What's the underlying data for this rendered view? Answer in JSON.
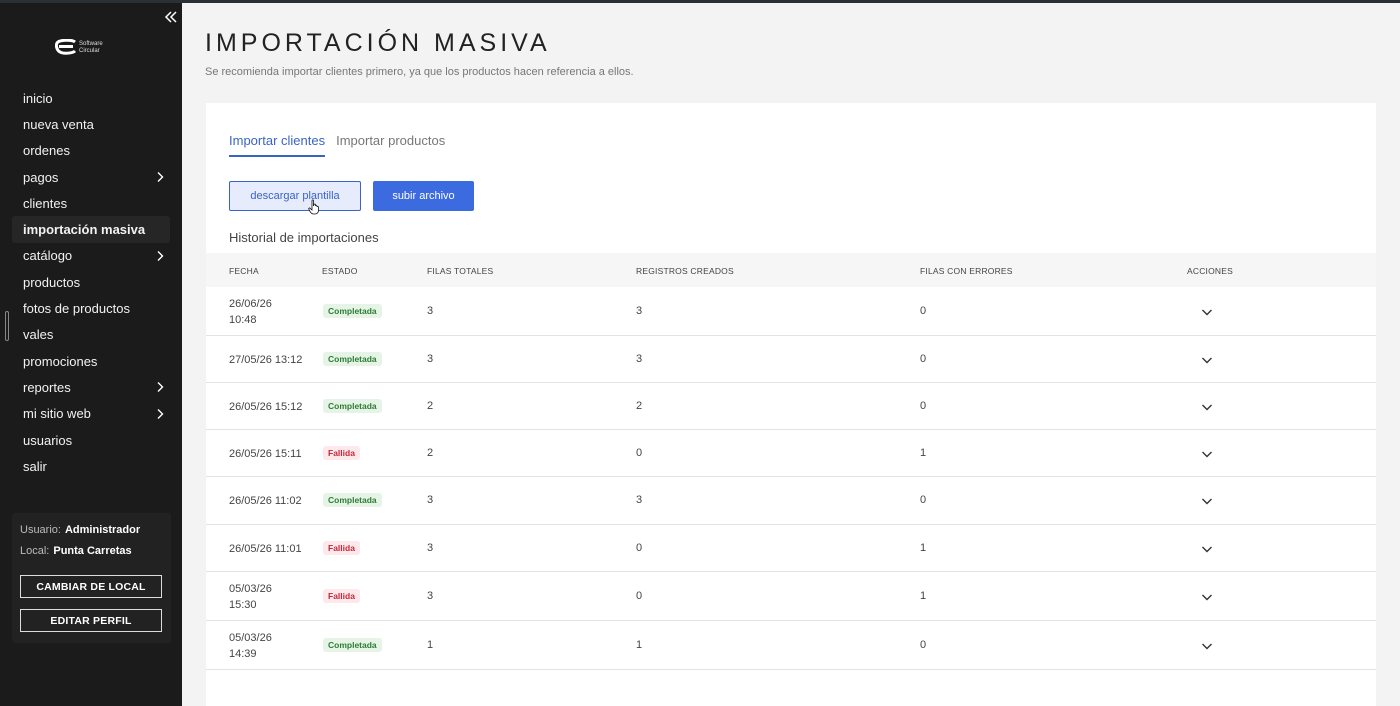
{
  "sidebar": {
    "logo_line1": "Software",
    "logo_line2": "Circular",
    "items": [
      {
        "label": "inicio",
        "has_submenu": false
      },
      {
        "label": "nueva venta",
        "has_submenu": false
      },
      {
        "label": "ordenes",
        "has_submenu": false
      },
      {
        "label": "pagos",
        "has_submenu": true
      },
      {
        "label": "clientes",
        "has_submenu": false
      },
      {
        "label": "importación masiva",
        "has_submenu": false,
        "active": true
      },
      {
        "label": "catálogo",
        "has_submenu": true
      },
      {
        "label": "productos",
        "has_submenu": false
      },
      {
        "label": "fotos de productos",
        "has_submenu": false
      },
      {
        "label": "vales",
        "has_submenu": false
      },
      {
        "label": "promociones",
        "has_submenu": false
      },
      {
        "label": "reportes",
        "has_submenu": true
      },
      {
        "label": "mi sitio web",
        "has_submenu": true
      },
      {
        "label": "usuarios",
        "has_submenu": false
      },
      {
        "label": "salir",
        "has_submenu": false
      }
    ],
    "user_label": "Usuario:",
    "user_value": "Administrador",
    "local_label": "Local:",
    "local_value": "Punta Carretas",
    "change_local_button": "CAMBIAR DE LOCAL",
    "edit_profile_button": "EDITAR PERFIL"
  },
  "page": {
    "title": "IMPORTACIÓN MASIVA",
    "subtitle": "Se recomienda importar clientes primero, ya que los productos hacen referencia a ellos.",
    "tabs": [
      {
        "label": "Importar clientes",
        "active": true
      },
      {
        "label": "Importar productos",
        "active": false
      }
    ],
    "download_button": "descargar plantilla",
    "upload_button": "subir archivo",
    "history_title": "Historial de importaciones"
  },
  "table": {
    "headers": [
      "FECHA",
      "ESTADO",
      "FILAS TOTALES",
      "REGISTROS CREADOS",
      "FILAS CON ERRORES",
      "ACCIONES"
    ],
    "rows": [
      {
        "date1": "26/06/26",
        "date2": "10:48",
        "status": "Completada",
        "ok": true,
        "total": "3",
        "created": "3",
        "errors": "0"
      },
      {
        "date1": "27/05/26 13:12",
        "date2": "",
        "status": "Completada",
        "ok": true,
        "total": "3",
        "created": "3",
        "errors": "0"
      },
      {
        "date1": "26/05/26 15:12",
        "date2": "",
        "status": "Completada",
        "ok": true,
        "total": "2",
        "created": "2",
        "errors": "0"
      },
      {
        "date1": "26/05/26 15:11",
        "date2": "",
        "status": "Fallida",
        "ok": false,
        "total": "2",
        "created": "0",
        "errors": "1"
      },
      {
        "date1": "26/05/26 11:02",
        "date2": "",
        "status": "Completada",
        "ok": true,
        "total": "3",
        "created": "3",
        "errors": "0"
      },
      {
        "date1": "26/05/26 11:01",
        "date2": "",
        "status": "Fallida",
        "ok": false,
        "total": "3",
        "created": "0",
        "errors": "1"
      },
      {
        "date1": "05/03/26",
        "date2": "15:30",
        "status": "Fallida",
        "ok": false,
        "total": "3",
        "created": "0",
        "errors": "1"
      },
      {
        "date1": "05/03/26",
        "date2": "14:39",
        "status": "Completada",
        "ok": true,
        "total": "1",
        "created": "1",
        "errors": "0"
      }
    ]
  },
  "colors": {
    "accent": "#3c6be0",
    "sidebar_bg": "#1b1b1b",
    "success": "#2e7d32",
    "danger": "#c62839"
  }
}
